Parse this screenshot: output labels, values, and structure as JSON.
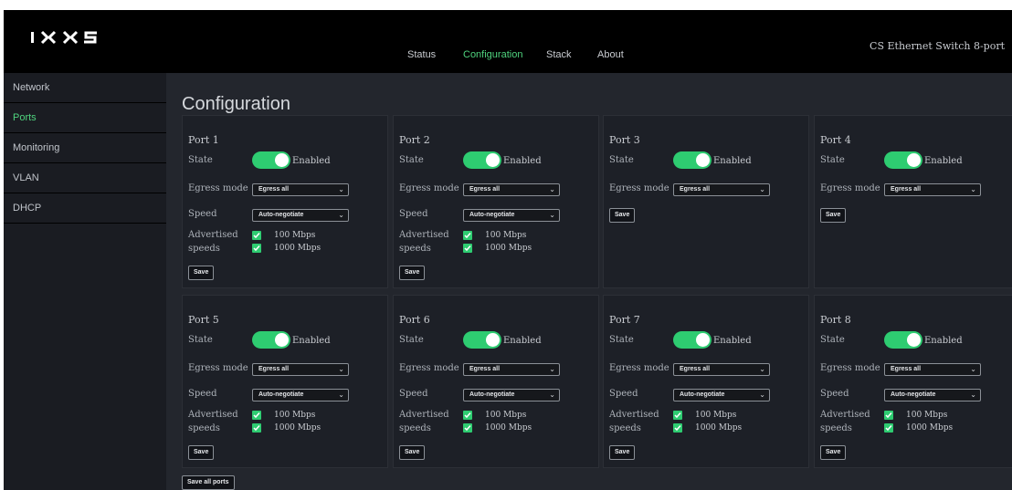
{
  "header": {
    "logo_text": "IXXS",
    "nav": [
      "Status",
      "Configuration",
      "Stack",
      "About"
    ],
    "active_nav": "Configuration",
    "product_name": "CS Ethernet Switch 8-port"
  },
  "sidebar": {
    "items": [
      {
        "label": "Network"
      },
      {
        "label": "Ports"
      },
      {
        "label": "Monitoring"
      },
      {
        "label": "VLAN"
      },
      {
        "label": "DHCP"
      }
    ],
    "active": "Ports"
  },
  "page": {
    "title": "Configuration",
    "labels": {
      "state": "State",
      "egress": "Egress mode",
      "speed": "Speed",
      "advertised_1": "Advertised",
      "advertised_2": "speeds",
      "save": "Save"
    },
    "save_all_label": "Save all ports"
  },
  "ports": [
    {
      "name": "Port 1",
      "state": "Enabled",
      "egress": "Egress all",
      "speed": "Auto-negotiate",
      "speeds": [
        "100 Mbps",
        "1000 Mbps"
      ]
    },
    {
      "name": "Port 2",
      "state": "Enabled",
      "egress": "Egress all",
      "speed": "Auto-negotiate",
      "speeds": [
        "100 Mbps",
        "1000 Mbps"
      ]
    },
    {
      "name": "Port 3",
      "state": "Enabled",
      "egress": "Egress all",
      "speed": null,
      "speeds": []
    },
    {
      "name": "Port 4",
      "state": "Enabled",
      "egress": "Egress all",
      "speed": null,
      "speeds": []
    },
    {
      "name": "Port 5",
      "state": "Enabled",
      "egress": "Egress all",
      "speed": "Auto-negotiate",
      "speeds": [
        "100 Mbps",
        "1000 Mbps"
      ]
    },
    {
      "name": "Port 6",
      "state": "Enabled",
      "egress": "Egress all",
      "speed": "Auto-negotiate",
      "speeds": [
        "100 Mbps",
        "1000 Mbps"
      ]
    },
    {
      "name": "Port 7",
      "state": "Enabled",
      "egress": "Egress all",
      "speed": "Auto-negotiate",
      "speeds": [
        "100 Mbps",
        "1000 Mbps"
      ]
    },
    {
      "name": "Port 8",
      "state": "Enabled",
      "egress": "Egress all",
      "speed": "Auto-negotiate",
      "speeds": [
        "100 Mbps",
        "1000 Mbps"
      ]
    }
  ],
  "colors": {
    "accent": "#4fd37e",
    "toggle_on": "#2ecc71",
    "background": "#1d2027",
    "topbar": "#000000"
  }
}
